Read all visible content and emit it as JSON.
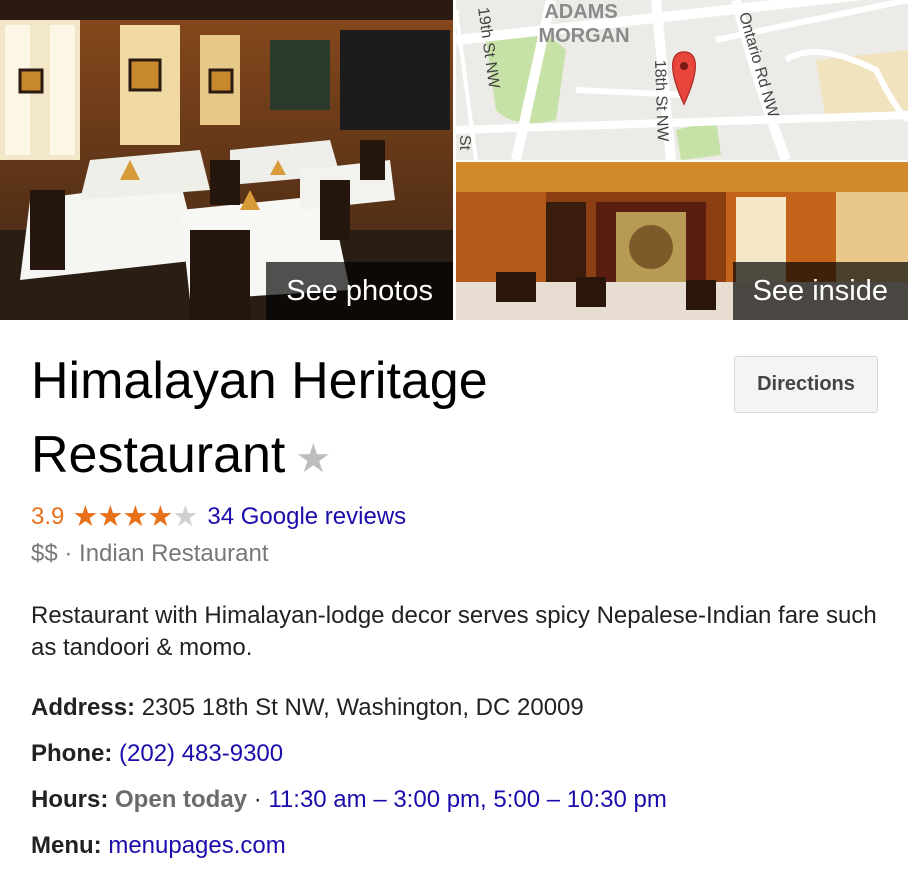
{
  "media": {
    "see_photos_label": "See photos",
    "see_inside_label": "See inside",
    "map": {
      "neighborhood_line1": "ADAMS",
      "neighborhood_line2": "MORGAN",
      "street_19th": "19th St NW",
      "street_18th": "18th St NW",
      "street_ontario": "Ontario Rd NW",
      "street_partial": "St",
      "pin_color": "#e8453c"
    }
  },
  "place": {
    "name": "Himalayan Heritage Restaurant",
    "save_star": "★",
    "directions_label": "Directions",
    "rating": "3.9",
    "rating_value": 3.9,
    "stars_on": "★★★★",
    "stars_off": "★",
    "reviews_label": "34 Google reviews",
    "category": "$$ · Indian Restaurant",
    "description": "Restaurant with Himalayan-lodge decor serves spicy Nepalese-Indian fare such as tandoori & momo."
  },
  "details": {
    "address_label": "Address:",
    "address_value": "2305 18th St NW, Washington, DC 20009",
    "phone_label": "Phone:",
    "phone_value": "(202) 483-9300",
    "hours_label": "Hours:",
    "hours_status": "Open today",
    "hours_sep": " · ",
    "hours_value": "11:30 am – 3:00 pm, 5:00 – 10:30 pm",
    "menu_label": "Menu:",
    "menu_value": "menupages.com"
  },
  "colors": {
    "rating_orange": "#e7711b",
    "link_blue": "#1a0dab",
    "muted_gray": "#777777"
  }
}
